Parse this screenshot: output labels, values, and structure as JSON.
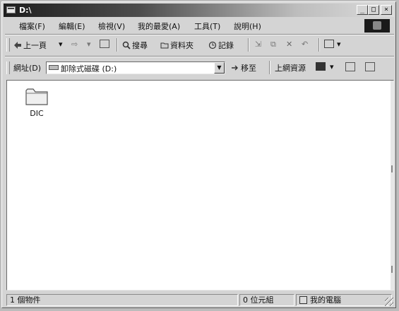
{
  "window": {
    "title": "D:\\",
    "controls": {
      "minimize": "_",
      "maximize": "□",
      "close": "×"
    }
  },
  "menubar": {
    "items": [
      "檔案(F)",
      "編輯(E)",
      "檢視(V)",
      "我的最愛(A)",
      "工具(T)",
      "說明(H)"
    ]
  },
  "toolbar": {
    "back_label": "上一頁",
    "forward_glyph": "⇨",
    "search_label": "搜尋",
    "folders_label": "資料夾",
    "history_label": "記錄"
  },
  "address": {
    "label": "網址(D)",
    "value": "卸除式磁碟 (D:)",
    "go_label": "移至",
    "links_label": "上網資源"
  },
  "content": {
    "items": [
      {
        "name": "DIC",
        "type": "folder"
      }
    ]
  },
  "statusbar": {
    "object_count": "1 個物件",
    "size": "0 位元組",
    "zone": "我的電腦"
  }
}
